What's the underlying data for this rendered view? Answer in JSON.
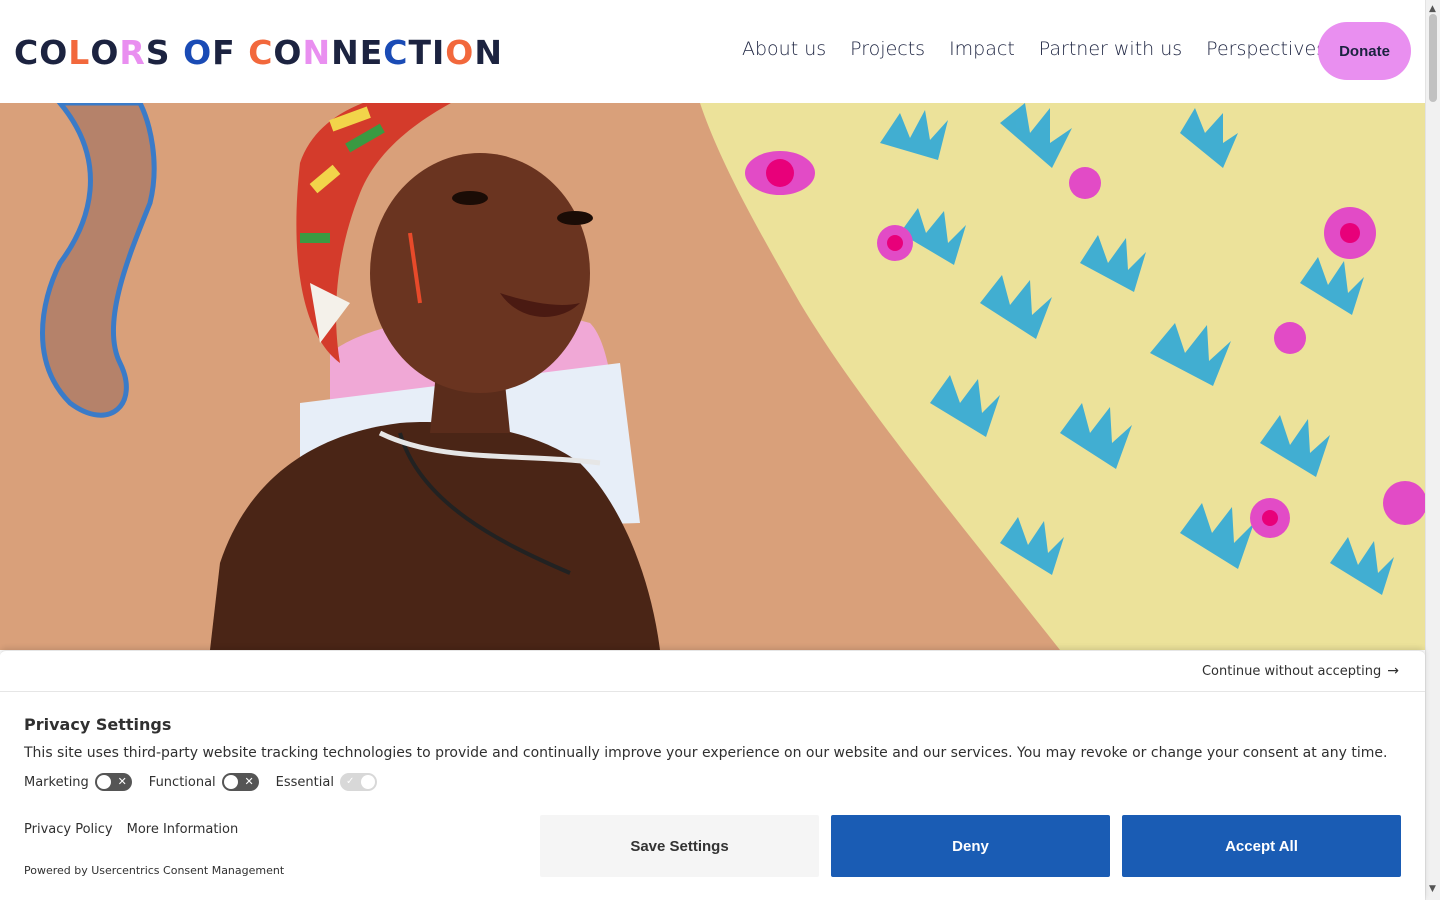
{
  "brand": {
    "logo_text": "COLORS OF CONNECTION"
  },
  "nav": {
    "items": [
      {
        "label": "About us"
      },
      {
        "label": "Projects"
      },
      {
        "label": "Impact"
      },
      {
        "label": "Partner with us"
      },
      {
        "label": "Perspectives"
      }
    ],
    "donate_label": "Donate"
  },
  "colors": {
    "accent_pink": "#e98ff0",
    "navy": "#1c2340",
    "button_blue": "#1a5cb4"
  },
  "consent": {
    "continue_label": "Continue without accepting",
    "title": "Privacy Settings",
    "description": "This site uses third-party website tracking technologies to provide and continually improve your experience on our website and our services. You may revoke or change your consent at any time.",
    "toggles": [
      {
        "label": "Marketing",
        "state": "off"
      },
      {
        "label": "Functional",
        "state": "off"
      },
      {
        "label": "Essential",
        "state": "on-disabled"
      }
    ],
    "privacy_policy_label": "Privacy Policy",
    "more_info_label": "More Information",
    "powered_by": "Powered by Usercentrics Consent Management",
    "save_label": "Save Settings",
    "deny_label": "Deny",
    "accept_label": "Accept All"
  }
}
